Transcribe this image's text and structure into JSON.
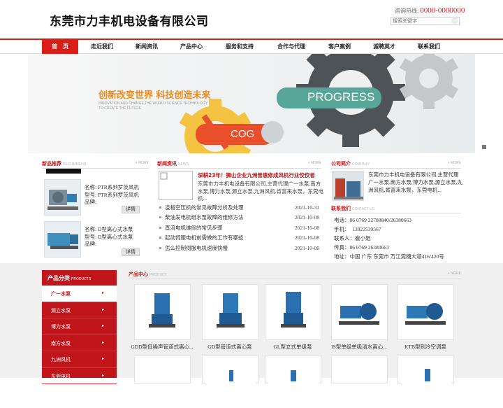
{
  "header": {
    "site_title": "东莞市力丰机电设备有限公司",
    "hotline_label": "咨询热线:",
    "hotline_number": "0000-0000000",
    "search_placeholder": "搜索关键字"
  },
  "nav": [
    "首　页",
    "走近我们",
    "新闻资讯",
    "产品中心",
    "服务和支持",
    "合作与代理",
    "客户案例",
    "诚聘英才",
    "联系我们"
  ],
  "banner": {
    "slogan": "创新改变世界 科技创造未来",
    "slogan_en": "INNOVATION AND CHANGE THE WORLD SCIENCE TECHNOLOGY TO CREATE THE FUTURE",
    "gear_big_label": "PROGRESS",
    "gear_small_label": "COG"
  },
  "new_products": {
    "title": "新品推荐",
    "title_en": "RECOMMEND",
    "more": "+ MORE",
    "items": [
      {
        "name": "名称: PTR系列罗茨风机",
        "model": "型号: PTR系列罗茨风机",
        "brand": "品牌:",
        "detail": "详情"
      },
      {
        "name": "名称: D型离心式水泵",
        "model": "型号: D型离心式水泵",
        "brand": "品牌:",
        "detail": "详情"
      }
    ]
  },
  "news": {
    "title": "新闻资讯",
    "title_en": "NEWS",
    "more": "+ MORE",
    "headline": "深耕23年！狮山企业九洲普惠修成风机行业佼佼者",
    "summary": "东莞市力丰机电设备有限公司,主营代理广一水泵,南方水泵,博力水泵,源立水泵,九洲风机,肯富来水泵，东莞电机...",
    "items": [
      {
        "title": "凌格空压机的常见故障分析及处理",
        "date": "2021-10-31"
      },
      {
        "title": "柴油发电机组水泵故障的维修方法",
        "date": "2021-10-08"
      },
      {
        "title": "直流电机维修的常见步骤",
        "date": "2021-10-08"
      },
      {
        "title": "起动伺服电机前需做的工作有哪些",
        "date": "2021-10-08"
      },
      {
        "title": "怎么控制伺服电机速度快慢",
        "date": "2021-10-08"
      }
    ]
  },
  "company": {
    "title": "公司简介",
    "title_en": "COMPANY",
    "more": "+ MORE",
    "intro": "东莞市力丰机电设备有限公司,主营代理广一水泵,南方水泵,博力水泵,源立水泵,九洲风机,肯富来水泵，东莞电机...",
    "contact_title": "联系我们",
    "contact_title_en": "CONTACT US",
    "contact": [
      "电话：86 0769 22788840/26380663",
      "手机：　13922539567",
      "联系人：崔小姐",
      "传真：86 0769 26380663",
      "地址：中国 广东 东莞市 万江莞穗大道416/420号"
    ]
  },
  "categories": {
    "title": "产品分类",
    "title_en": "PRODUCTS",
    "items": [
      "广一水泵",
      "源立水泵",
      "博力水泵",
      "南方水泵",
      "九洲风机",
      "东莞电机"
    ],
    "arrow": "▸"
  },
  "product_center": {
    "title": "产品中心",
    "title_en": "PRODUCT",
    "more": "+ MORE",
    "items": [
      "GDD型低噪声管道式离心...",
      "GD型管道式离心泵",
      "GL型立式单级泵",
      "IS型单级单吸清水离心...",
      "KTB型制冷空调泵"
    ]
  },
  "colors": {
    "brand_red": "#d91e18",
    "accent_orange": "#f08a1c",
    "hotline_red": "#e3161b"
  }
}
